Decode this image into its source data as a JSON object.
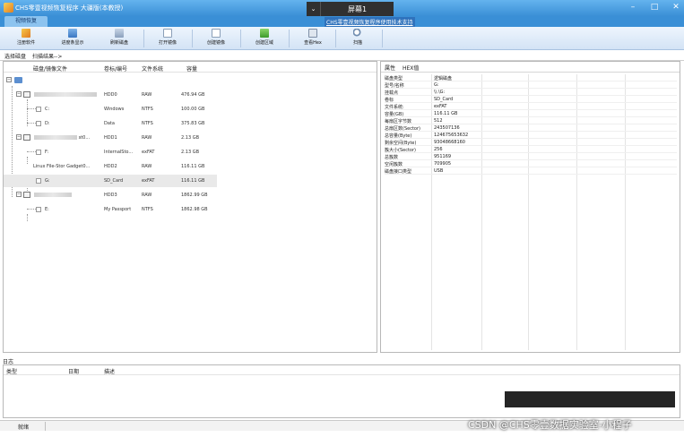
{
  "window": {
    "title": "CHS零壹视频恢复程序 大疆版(本教授)",
    "controls": [
      "–",
      "□",
      "✕"
    ]
  },
  "screen_overlay": {
    "chevron": "⌄",
    "label": "屏幕1"
  },
  "ribbon": {
    "tab": "视频恢复",
    "help_link": "CHS零壹视频恢复程序使用技术支持"
  },
  "toolbar": {
    "register": "注册软件",
    "progress": "进度条显示",
    "refresh": "刷新磁盘",
    "open_image": "打开镜像",
    "create_image": "创建镜像",
    "create_region": "创建区域",
    "view_hex": "查看Hex",
    "scan": "扫描"
  },
  "subtabs": {
    "select_disk": "选择磁盘",
    "scan_results": "扫描结果-->"
  },
  "tree": {
    "columns": [
      "磁盘/镜像文件",
      "卷标/编号",
      "文件系统",
      "容量"
    ],
    "rows": [
      {
        "name": "",
        "label": "",
        "fs": "",
        "size": ""
      },
      {
        "name": "",
        "label": "HDD0",
        "fs": "RAW",
        "size": "476.94 GB"
      },
      {
        "name": "C:",
        "label": "Windows",
        "fs": "NTFS",
        "size": "100.00 GB"
      },
      {
        "name": "D:",
        "label": "Data",
        "fs": "NTFS",
        "size": "375.83 GB"
      },
      {
        "name": "st0...",
        "label": "HDD1",
        "fs": "RAW",
        "size": "2.13 GB"
      },
      {
        "name": "F:",
        "label": "InternalSto...",
        "fs": "exFAT",
        "size": "2.13 GB"
      },
      {
        "name": "Linux   File-Stor Gadget0...",
        "label": "HDD2",
        "fs": "RAW",
        "size": "116.11 GB"
      },
      {
        "name": "G:",
        "label": "SD_Card",
        "fs": "exFAT",
        "size": "116.11 GB"
      },
      {
        "name": "",
        "label": "HDD3",
        "fs": "RAW",
        "size": "1862.99 GB"
      },
      {
        "name": "E:",
        "label": "My Passport",
        "fs": "NTFS",
        "size": "1862.98 GB"
      }
    ]
  },
  "properties": {
    "tabs": [
      "属性",
      "HEX值"
    ],
    "items": [
      {
        "k": "磁盘类型",
        "v": "逻辑磁盘"
      },
      {
        "k": "型号/名称",
        "v": "G:"
      },
      {
        "k": "挂载点",
        "v": "\\\\.\\G:"
      },
      {
        "k": "卷标",
        "v": "SD_Card"
      },
      {
        "k": "文件系统:",
        "v": "exFAT"
      },
      {
        "k": "容量(GB)",
        "v": "116.11 GB"
      },
      {
        "k": "每扇区字节数",
        "v": "512"
      },
      {
        "k": "总扇区数(Sector)",
        "v": "243507136"
      },
      {
        "k": "总容量(Byte)",
        "v": "124675653632"
      },
      {
        "k": "剩余空间(Byte)",
        "v": "93048668160"
      },
      {
        "k": "簇大小(Sector)",
        "v": "256"
      },
      {
        "k": "总簇数",
        "v": "951169"
      },
      {
        "k": "空闲簇数",
        "v": "709905"
      },
      {
        "k": "磁盘接口类型",
        "v": "USB"
      }
    ]
  },
  "log": {
    "label": "日志",
    "columns": [
      "类型",
      "日期",
      "描述"
    ]
  },
  "status": {
    "text": "就绪"
  },
  "watermark": "CSDN @CHS零壹数据实验室-小程子",
  "colors": {
    "titlebar": "#3a8fd6",
    "ribbon_tab": "#8cc3ef",
    "selected_row": "#e9e9e9"
  }
}
